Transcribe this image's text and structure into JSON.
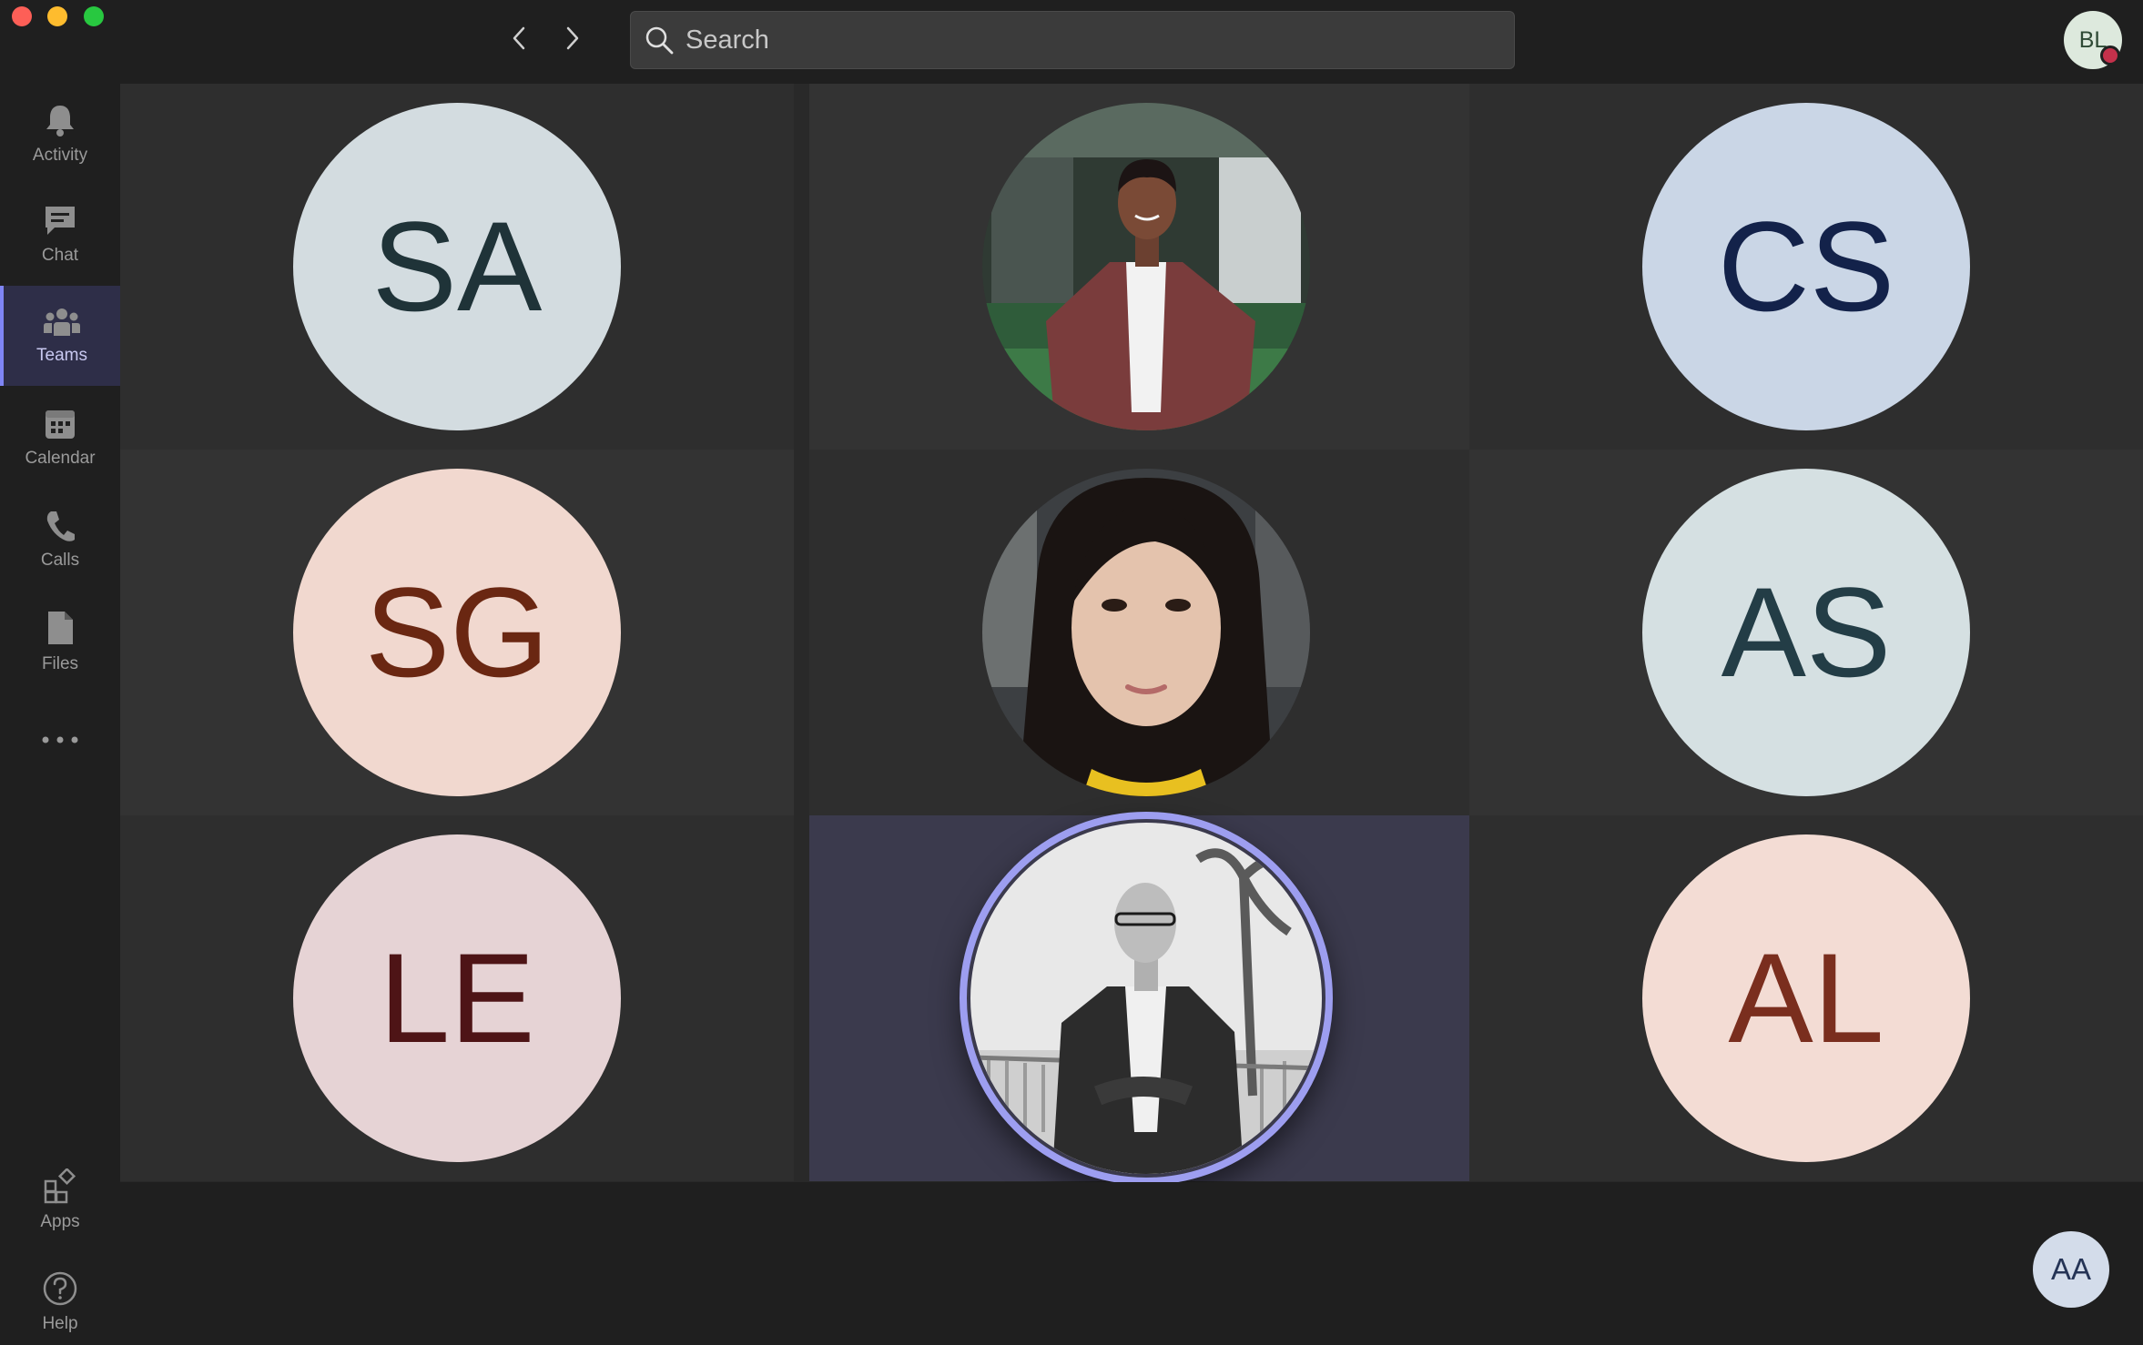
{
  "window": {
    "controls": [
      "close",
      "minimize",
      "maximize"
    ]
  },
  "search": {
    "placeholder": "Search"
  },
  "me": {
    "initials": "BL",
    "status_color": "#c4314b"
  },
  "rail": {
    "items": [
      {
        "label": "Activity",
        "icon": "bell-icon"
      },
      {
        "label": "Chat",
        "icon": "chat-icon"
      },
      {
        "label": "Teams",
        "icon": "teams-icon",
        "active": true
      },
      {
        "label": "Calendar",
        "icon": "calendar-icon"
      },
      {
        "label": "Calls",
        "icon": "phone-icon"
      },
      {
        "label": "Files",
        "icon": "file-icon"
      },
      {
        "label": "",
        "icon": "more-icon"
      }
    ],
    "bottom": [
      {
        "label": "Apps",
        "icon": "apps-icon"
      },
      {
        "label": "Help",
        "icon": "help-icon"
      }
    ]
  },
  "participants": [
    {
      "initials": "SA",
      "bg": "#d3dce0",
      "fg": "#1f3338"
    },
    {
      "photo": "man-brown-blazer",
      "initials": ""
    },
    {
      "initials": "CS",
      "bg": "#cad6e6",
      "fg": "#13224a"
    },
    {
      "initials": "SG",
      "bg": "#f1d8cf",
      "fg": "#6a2712"
    },
    {
      "photo": "woman-portrait",
      "initials": ""
    },
    {
      "initials": "AS",
      "bg": "#d5e0e2",
      "fg": "#233d46"
    },
    {
      "initials": "LE",
      "bg": "#e6d3d5",
      "fg": "#4e1416"
    },
    {
      "photo": "man-bw-speaking",
      "initials": "",
      "speaking": true
    },
    {
      "initials": "AL",
      "bg": "#f3dcd4",
      "fg": "#7a2e1e"
    }
  ],
  "self": {
    "initials": "AA"
  },
  "colors": {
    "accent": "#7f85f5",
    "speaking_ring": "#9d9ef0"
  }
}
